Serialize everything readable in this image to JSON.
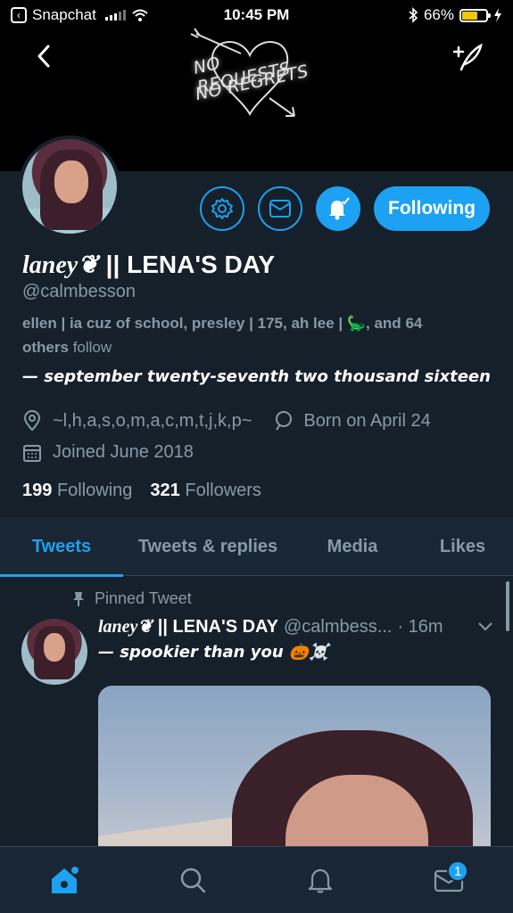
{
  "status_bar": {
    "back_app": "Snapchat",
    "time": "10:45 PM",
    "battery": "66%",
    "battery_level": 0.66
  },
  "banner": {
    "line1": "NO REQUESTS",
    "line2": "NO REGRETS"
  },
  "profile": {
    "name_script": "laney❦",
    "name_rest": "|| LENA'S DAY",
    "handle": "@calmbesson",
    "followed_by_text": "ellen | ia cuz of school, presley | 175, ah lee | 🦕, and",
    "followed_by_count": "64",
    "followed_by_others": "others",
    "followed_by_suffix": "follow",
    "bio": "— september twenty-seventh two thousand sixteen",
    "location": "~l,h,a,s,o,m,a,c,m,t,j,k,p~",
    "birthday": "Born on April 24",
    "joined": "Joined June 2018",
    "following_count": "199",
    "following_label": "Following",
    "followers_count": "321",
    "followers_label": "Followers",
    "follow_button": "Following"
  },
  "tabs": [
    {
      "label": "Tweets",
      "active": true
    },
    {
      "label": "Tweets & replies",
      "active": false
    },
    {
      "label": "Media",
      "active": false
    },
    {
      "label": "Likes",
      "active": false
    }
  ],
  "tweet": {
    "pinned_label": "Pinned Tweet",
    "name_script": "laney❦",
    "name_rest": "|| LENA'S DAY",
    "handle": "@calmbess...",
    "time": "· 16m",
    "text": "— spookier than you 🎃☠️"
  },
  "bottom_nav": {
    "messages_badge": "1"
  },
  "colors": {
    "background": "#15202b",
    "accent": "#1da1f2",
    "muted": "#8899a6"
  }
}
